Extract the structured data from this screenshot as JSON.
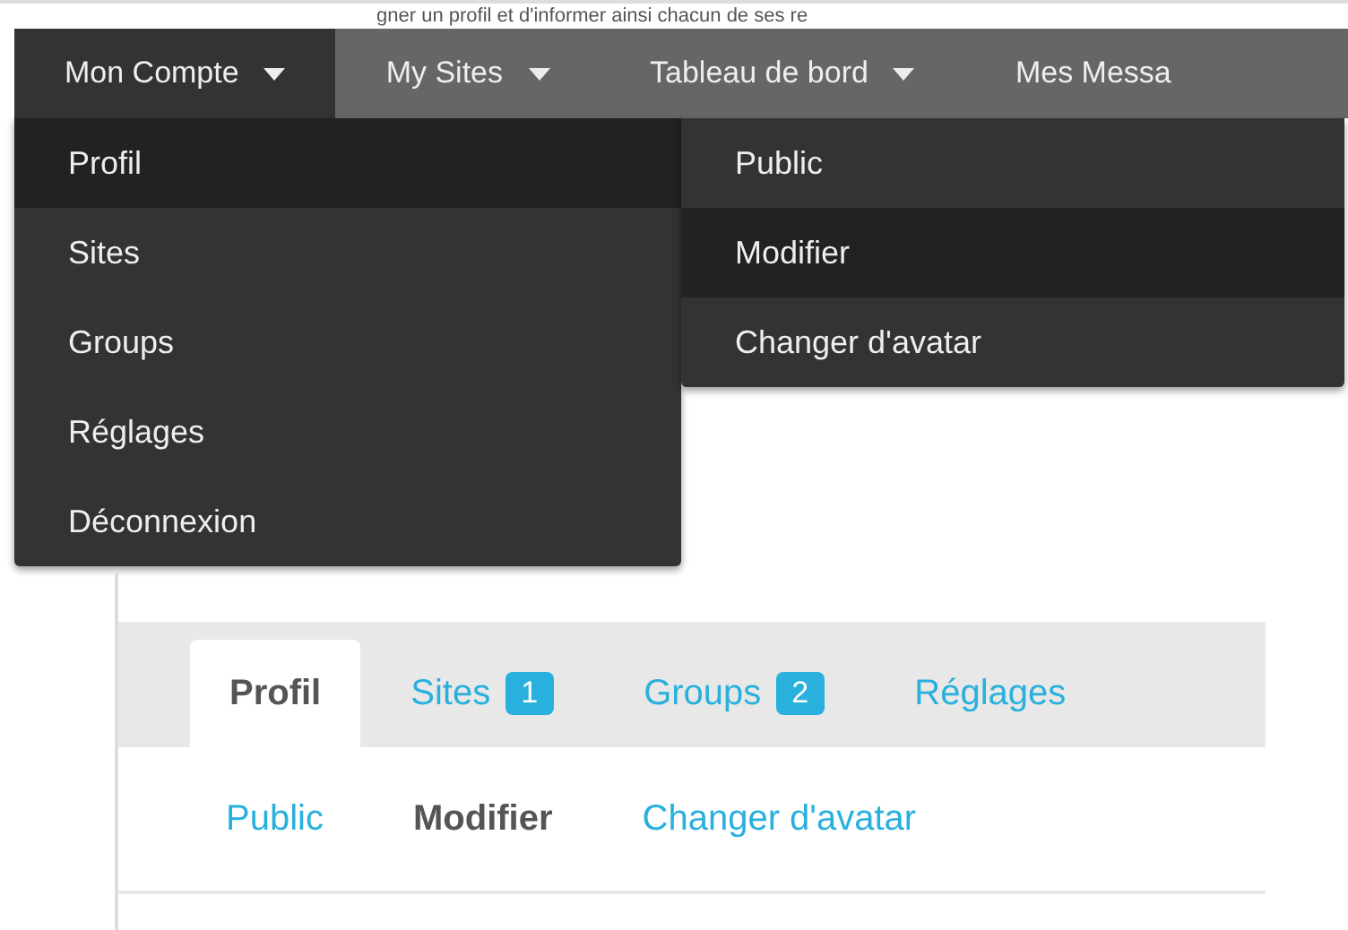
{
  "background_text": "gner un profil et d'informer ainsi chacun de ses re",
  "menu_bar": [
    {
      "label": "Mon Compte",
      "selected": true,
      "caret": true
    },
    {
      "label": "My Sites",
      "selected": false,
      "caret": true
    },
    {
      "label": "Tableau de bord",
      "selected": false,
      "caret": true
    },
    {
      "label": "Mes Messa",
      "selected": false,
      "caret": false
    }
  ],
  "dropdown": [
    {
      "label": "Profil",
      "selected": true
    },
    {
      "label": "Sites",
      "selected": false
    },
    {
      "label": "Groups",
      "selected": false
    },
    {
      "label": "Réglages",
      "selected": false
    },
    {
      "label": "Déconnexion",
      "selected": false
    }
  ],
  "submenu": [
    {
      "label": "Public",
      "selected": false
    },
    {
      "label": "Modifier",
      "selected": true
    },
    {
      "label": "Changer d'avatar",
      "selected": false
    }
  ],
  "tabs": [
    {
      "label": "Profil",
      "selected": true
    },
    {
      "label": "Sites",
      "selected": false,
      "count": "1"
    },
    {
      "label": "Groups",
      "selected": false,
      "count": "2"
    },
    {
      "label": "Réglages",
      "selected": false
    }
  ],
  "subnav": [
    {
      "label": "Public",
      "selected": false
    },
    {
      "label": "Modifier",
      "selected": true
    },
    {
      "label": "Changer d'avatar",
      "selected": false
    }
  ]
}
